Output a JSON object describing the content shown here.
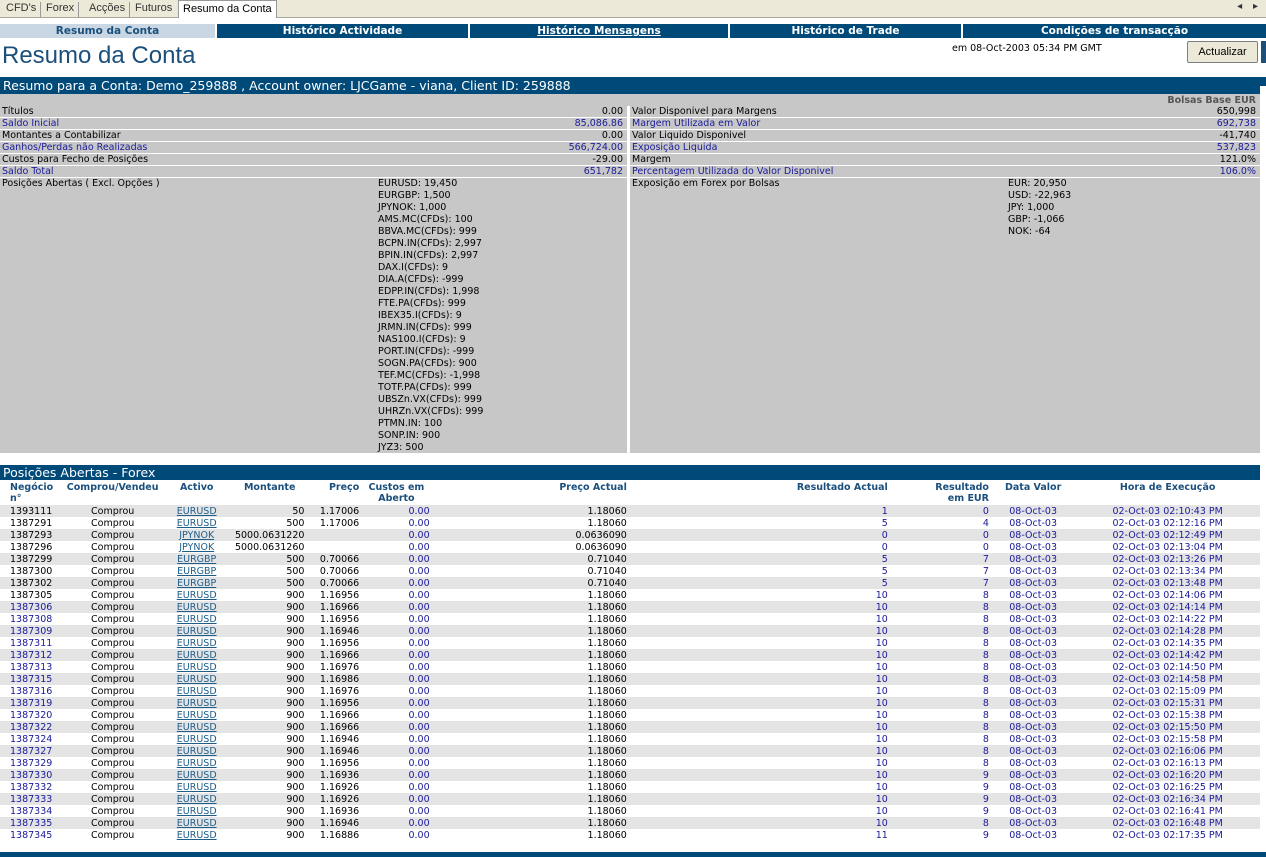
{
  "tabs": [
    {
      "label": "CFD's"
    },
    {
      "label": "Forex"
    },
    {
      "label": "Acções"
    },
    {
      "label": "Futuros"
    },
    {
      "label": "Resumo da Conta"
    }
  ],
  "tab_scroll": "◂ ▸",
  "nav": [
    {
      "label": "Resumo da Conta"
    },
    {
      "label": "Histórico Actividade"
    },
    {
      "label": "Histórico Mensagens"
    },
    {
      "label": "Histórico de Trade"
    },
    {
      "label": "Condições de transacção"
    }
  ],
  "page_title": "Resumo da Conta",
  "datetime": "em 08-Oct-2003 05:34 PM GMT",
  "refresh_button": "Actualizar",
  "banner": "Resumo para a Conta: Demo_259888 ,  Account owner: LJCGame - viana,   Client ID: 259888",
  "base_currency_label": "Bolsas Base EUR",
  "left_rows": [
    {
      "label": "Títulos",
      "value": "0.00"
    },
    {
      "label": "Saldo Inicial",
      "value": "85,086.86"
    },
    {
      "label": "Montantes a Contabilizar",
      "value": "0.00"
    },
    {
      "label": "Ganhos/Perdas não Realizadas",
      "value": "566,724.00"
    },
    {
      "label": "Custos para Fecho de Posições",
      "value": "-29.00"
    },
    {
      "label": "Saldo Total",
      "value": "651,782"
    }
  ],
  "right_rows": [
    {
      "label": "Valor Disponivel para Margens",
      "value": "650,998"
    },
    {
      "label": "Margem Utilizada em Valor",
      "value": "692,738"
    },
    {
      "label": "Valor Liquido Disponivel",
      "value": "-41,740"
    },
    {
      "label": "Exposição Liquida",
      "value": "537,823"
    },
    {
      "label": "Margem",
      "value": "121.0%"
    },
    {
      "label": "Percentagem Utilizada do Valor Disponivel",
      "value": "106.0%"
    }
  ],
  "open_positions_label": "Posições Abertas ( Excl. Opções )",
  "open_positions": [
    "EURUSD: 19,450",
    "EURGBP: 1,500",
    "JPYNOK: 1,000",
    "AMS.MC(CFDs): 100",
    "BBVA.MC(CFDs): 999",
    "BCPN.IN(CFDs): 2,997",
    "BPIN.IN(CFDs): 2,997",
    "DAX.I(CFDs): 9",
    "DIA.A(CFDs): -999",
    "EDPP.IN(CFDs): 1,998",
    "FTE.PA(CFDs): 999",
    "IBEX35.I(CFDs): 9",
    "JRMN.IN(CFDs): 999",
    "NAS100.I(CFDs): 9",
    "PORT.IN(CFDs): -999",
    "SOGN.PA(CFDs): 900",
    "TEF.MC(CFDs): -1,998",
    "TOTF.PA(CFDs): 999",
    "UBSZn.VX(CFDs): 999",
    "UHRZn.VX(CFDs): 999",
    "PTMN.IN: 100",
    "SONP.IN: 900",
    "JYZ3: 500"
  ],
  "forex_exposure_label": "Exposição em Forex por Bolsas",
  "forex_exposure": [
    "EUR: 20,950",
    "USD: -22,963",
    "JPY: 1,000",
    "GBP: -1,066",
    "NOK: -64"
  ],
  "forex_section_title": "Posições Abertas - Forex",
  "table_headers": {
    "negocio_1": "Negócio",
    "negocio_2": "n°",
    "comprou": "Comprou/Vendeu",
    "activo": "Activo",
    "montante": "Montante",
    "preco": "Preço",
    "custos_1": "Custos em",
    "custos_2": "Aberto",
    "preco_actual": "Preço Actual",
    "resultado_actual": "Resultado Actual",
    "resultado_eur_1": "Resultado",
    "resultado_eur_2": "em EUR",
    "data_valor": "Data Valor",
    "hora": "Hora de Execução"
  },
  "trades": [
    [
      "1393111",
      "Comprou",
      "EURUSD",
      "50",
      "1.17006",
      "0.00",
      "1.18060",
      "1",
      "0",
      "08-Oct-03",
      "02-Oct-03 02:10:43 PM"
    ],
    [
      "1387291",
      "Comprou",
      "EURUSD",
      "500",
      "1.17006",
      "0.00",
      "1.18060",
      "5",
      "4",
      "08-Oct-03",
      "02-Oct-03 02:12:16 PM"
    ],
    [
      "1387293",
      "Comprou",
      "JPYNOK",
      "5000.0631220",
      "",
      "0.00",
      "0.0636090",
      "0",
      "0",
      "08-Oct-03",
      "02-Oct-03 02:12:49 PM"
    ],
    [
      "1387296",
      "Comprou",
      "JPYNOK",
      "5000.0631260",
      "",
      "0.00",
      "0.0636090",
      "0",
      "0",
      "08-Oct-03",
      "02-Oct-03 02:13:04 PM"
    ],
    [
      "1387299",
      "Comprou",
      "EURGBP",
      "500",
      "0.70066",
      "0.00",
      "0.71040",
      "5",
      "7",
      "08-Oct-03",
      "02-Oct-03 02:13:26 PM"
    ],
    [
      "1387300",
      "Comprou",
      "EURGBP",
      "500",
      "0.70066",
      "0.00",
      "0.71040",
      "5",
      "7",
      "08-Oct-03",
      "02-Oct-03 02:13:34 PM"
    ],
    [
      "1387302",
      "Comprou",
      "EURGBP",
      "500",
      "0.70066",
      "0.00",
      "0.71040",
      "5",
      "7",
      "08-Oct-03",
      "02-Oct-03 02:13:48 PM"
    ],
    [
      "1387305",
      "Comprou",
      "EURUSD",
      "900",
      "1.16956",
      "0.00",
      "1.18060",
      "10",
      "8",
      "08-Oct-03",
      "02-Oct-03 02:14:06 PM"
    ],
    [
      "1387306",
      "Comprou",
      "EURUSD",
      "900",
      "1.16966",
      "0.00",
      "1.18060",
      "10",
      "8",
      "08-Oct-03",
      "02-Oct-03 02:14:14 PM"
    ],
    [
      "1387308",
      "Comprou",
      "EURUSD",
      "900",
      "1.16956",
      "0.00",
      "1.18060",
      "10",
      "8",
      "08-Oct-03",
      "02-Oct-03 02:14:22 PM"
    ],
    [
      "1387309",
      "Comprou",
      "EURUSD",
      "900",
      "1.16946",
      "0.00",
      "1.18060",
      "10",
      "8",
      "08-Oct-03",
      "02-Oct-03 02:14:28 PM"
    ],
    [
      "1387311",
      "Comprou",
      "EURUSD",
      "900",
      "1.16956",
      "0.00",
      "1.18060",
      "10",
      "8",
      "08-Oct-03",
      "02-Oct-03 02:14:35 PM"
    ],
    [
      "1387312",
      "Comprou",
      "EURUSD",
      "900",
      "1.16966",
      "0.00",
      "1.18060",
      "10",
      "8",
      "08-Oct-03",
      "02-Oct-03 02:14:42 PM"
    ],
    [
      "1387313",
      "Comprou",
      "EURUSD",
      "900",
      "1.16976",
      "0.00",
      "1.18060",
      "10",
      "8",
      "08-Oct-03",
      "02-Oct-03 02:14:50 PM"
    ],
    [
      "1387315",
      "Comprou",
      "EURUSD",
      "900",
      "1.16986",
      "0.00",
      "1.18060",
      "10",
      "8",
      "08-Oct-03",
      "02-Oct-03 02:14:58 PM"
    ],
    [
      "1387316",
      "Comprou",
      "EURUSD",
      "900",
      "1.16976",
      "0.00",
      "1.18060",
      "10",
      "8",
      "08-Oct-03",
      "02-Oct-03 02:15:09 PM"
    ],
    [
      "1387319",
      "Comprou",
      "EURUSD",
      "900",
      "1.16956",
      "0.00",
      "1.18060",
      "10",
      "8",
      "08-Oct-03",
      "02-Oct-03 02:15:31 PM"
    ],
    [
      "1387320",
      "Comprou",
      "EURUSD",
      "900",
      "1.16966",
      "0.00",
      "1.18060",
      "10",
      "8",
      "08-Oct-03",
      "02-Oct-03 02:15:38 PM"
    ],
    [
      "1387322",
      "Comprou",
      "EURUSD",
      "900",
      "1.16966",
      "0.00",
      "1.18060",
      "10",
      "8",
      "08-Oct-03",
      "02-Oct-03 02:15:50 PM"
    ],
    [
      "1387324",
      "Comprou",
      "EURUSD",
      "900",
      "1.16946",
      "0.00",
      "1.18060",
      "10",
      "8",
      "08-Oct-03",
      "02-Oct-03 02:15:58 PM"
    ],
    [
      "1387327",
      "Comprou",
      "EURUSD",
      "900",
      "1.16946",
      "0.00",
      "1.18060",
      "10",
      "8",
      "08-Oct-03",
      "02-Oct-03 02:16:06 PM"
    ],
    [
      "1387329",
      "Comprou",
      "EURUSD",
      "900",
      "1.16956",
      "0.00",
      "1.18060",
      "10",
      "8",
      "08-Oct-03",
      "02-Oct-03 02:16:13 PM"
    ],
    [
      "1387330",
      "Comprou",
      "EURUSD",
      "900",
      "1.16936",
      "0.00",
      "1.18060",
      "10",
      "9",
      "08-Oct-03",
      "02-Oct-03 02:16:20 PM"
    ],
    [
      "1387332",
      "Comprou",
      "EURUSD",
      "900",
      "1.16926",
      "0.00",
      "1.18060",
      "10",
      "9",
      "08-Oct-03",
      "02-Oct-03 02:16:25 PM"
    ],
    [
      "1387333",
      "Comprou",
      "EURUSD",
      "900",
      "1.16926",
      "0.00",
      "1.18060",
      "10",
      "9",
      "08-Oct-03",
      "02-Oct-03 02:16:34 PM"
    ],
    [
      "1387334",
      "Comprou",
      "EURUSD",
      "900",
      "1.16936",
      "0.00",
      "1.18060",
      "10",
      "9",
      "08-Oct-03",
      "02-Oct-03 02:16:41 PM"
    ],
    [
      "1387335",
      "Comprou",
      "EURUSD",
      "900",
      "1.16946",
      "0.00",
      "1.18060",
      "10",
      "8",
      "08-Oct-03",
      "02-Oct-03 02:16:48 PM"
    ],
    [
      "1387345",
      "Comprou",
      "EURUSD",
      "900",
      "1.16886",
      "0.00",
      "1.18060",
      "11",
      "9",
      "08-Oct-03",
      "02-Oct-03 02:17:35 PM"
    ]
  ]
}
